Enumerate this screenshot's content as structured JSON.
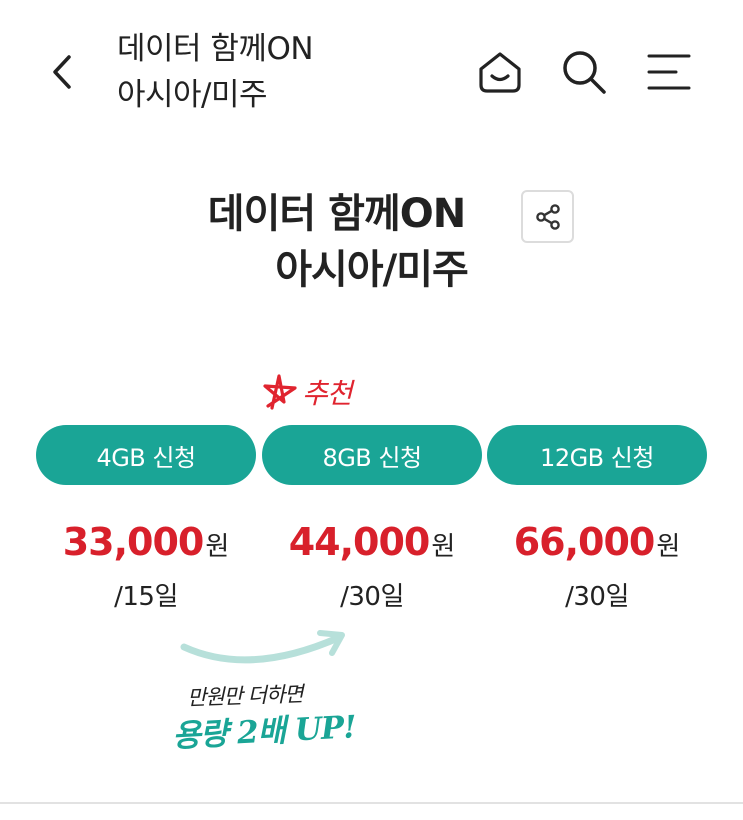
{
  "header": {
    "title_line1": "데이터 함께ON",
    "title_line2": "아시아/미주",
    "icons": [
      "back-icon",
      "home-icon",
      "search-icon",
      "menu-icon"
    ]
  },
  "product": {
    "title_line1": "데이터 함께ON",
    "title_line2": "아시아/미주",
    "share_icon": "share-icon"
  },
  "recommend_label": "추천",
  "plans": [
    {
      "button_label": "4GB 신청",
      "price": "33,000",
      "unit": "원",
      "period": "/15일"
    },
    {
      "button_label": "8GB 신청",
      "price": "44,000",
      "unit": "원",
      "period": "/30일"
    },
    {
      "button_label": "12GB 신청",
      "price": "66,000",
      "unit": "원",
      "period": "/30일"
    }
  ],
  "promo": {
    "line1": "만원만 더하면",
    "line2": "용량 2배 UP!"
  },
  "colors": {
    "accent_teal": "#1aa596",
    "price_red": "#d8202b",
    "recommend_red": "#e0242f"
  }
}
